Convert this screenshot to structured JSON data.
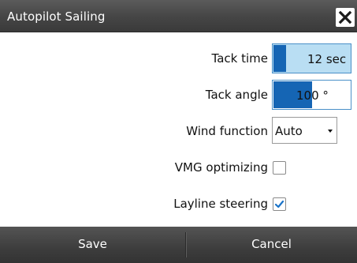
{
  "dialog": {
    "title": "Autopilot Sailing",
    "close_icon": "close-icon"
  },
  "settings": {
    "tack_time": {
      "label": "Tack time",
      "value": "12 sec",
      "level": 0.16
    },
    "tack_angle": {
      "label": "Tack angle",
      "value": "100 °",
      "level": 0.5
    },
    "wind_function": {
      "label": "Wind function",
      "selected": "Auto"
    },
    "vmg_optimizing": {
      "label": "VMG optimizing",
      "checked": false
    },
    "layline_steering": {
      "label": "Layline steering",
      "checked": true
    }
  },
  "footer": {
    "save_label": "Save",
    "cancel_label": "Cancel"
  },
  "colors": {
    "accent": "#1565b4",
    "highlight": "#b9def3",
    "check": "#1a73c8",
    "bar": "#3a3a3a"
  }
}
